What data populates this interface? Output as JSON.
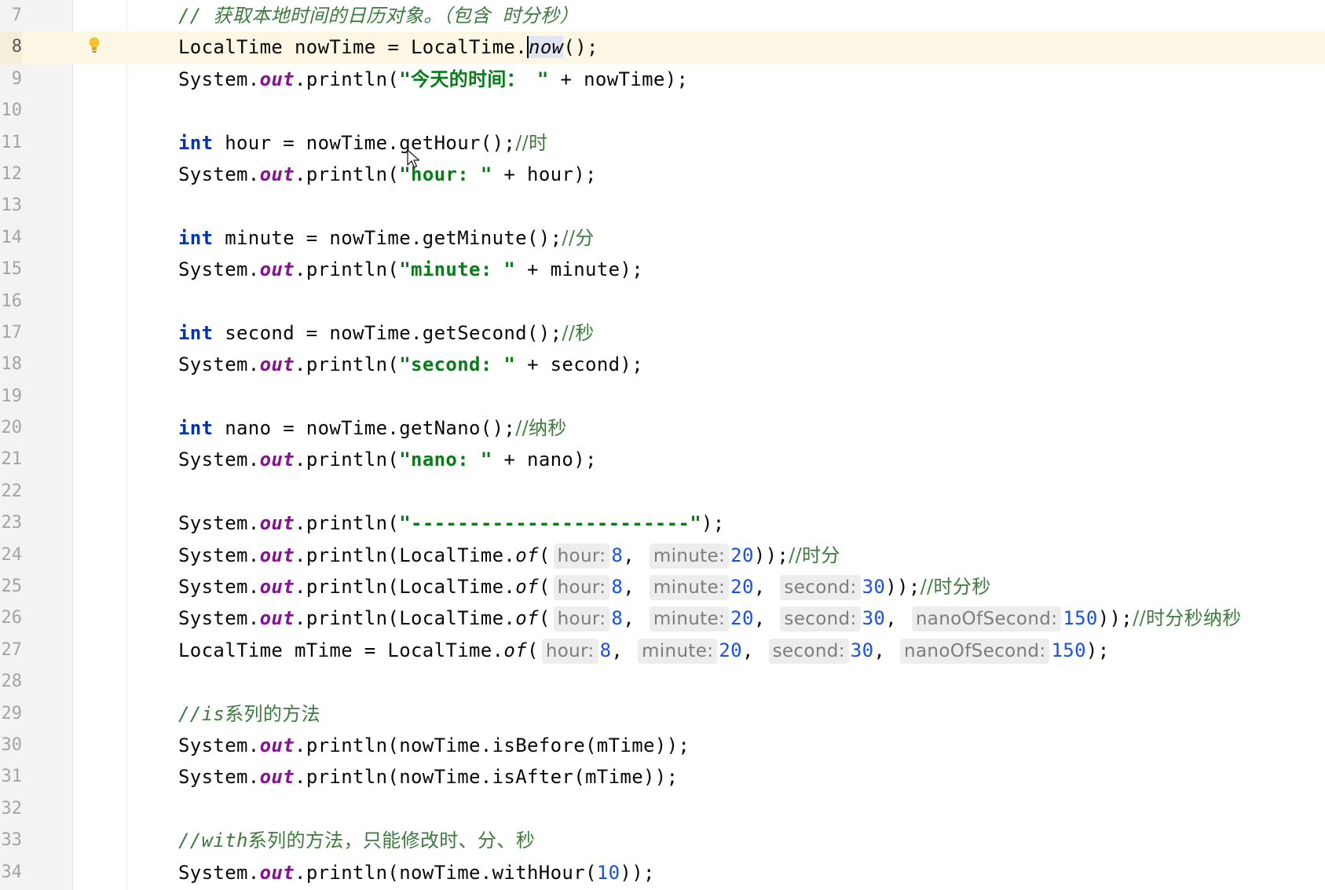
{
  "editor": {
    "language": "java",
    "current_line": "8",
    "lines": [
      {
        "num": "7"
      },
      {
        "num": "8"
      },
      {
        "num": "9"
      },
      {
        "num": "10"
      },
      {
        "num": "11"
      },
      {
        "num": "12"
      },
      {
        "num": "13"
      },
      {
        "num": "14"
      },
      {
        "num": "15"
      },
      {
        "num": "16"
      },
      {
        "num": "17"
      },
      {
        "num": "18"
      },
      {
        "num": "19"
      },
      {
        "num": "20"
      },
      {
        "num": "21"
      },
      {
        "num": "22"
      },
      {
        "num": "23"
      },
      {
        "num": "24"
      },
      {
        "num": "25"
      },
      {
        "num": "26"
      },
      {
        "num": "27"
      },
      {
        "num": "28"
      },
      {
        "num": "29"
      },
      {
        "num": "30"
      },
      {
        "num": "31"
      },
      {
        "num": "32"
      },
      {
        "num": "33"
      },
      {
        "num": "34"
      }
    ]
  },
  "t": {
    "c7": "// 获取本地时间的日历对象。（包含 时分秒）",
    "LocalTime": "LocalTime",
    "nowTime_eq": " nowTime = ",
    "dot": ".",
    "now": "now",
    "paren_semi": "();",
    "System": "System",
    "out": "out",
    "println_open": ".println(",
    "s9": "\"今天的时间： \"",
    "plus_nowTime": " + nowTime);",
    "int": "int",
    "hour_decl": " hour = nowTime.getHour();",
    "c11": "//时",
    "s12": "\"hour: \"",
    "plus_hour": " + hour);",
    "minute_decl": " minute = nowTime.getMinute();",
    "c14": "//分",
    "s15": "\"minute: \"",
    "plus_minute": " + minute);",
    "second_decl": " second = nowTime.getSecond();",
    "c17": "//秒",
    "s18": "\"second: \"",
    "plus_second": " + second);",
    "nano_decl": " nano = nowTime.getNano();",
    "c20": "//纳秒",
    "s21": "\"nano: \"",
    "plus_nano": " + nano);",
    "s23": "\"------------------------\"",
    "close_semi": ");",
    "println_lt": ".println(LocalTime.",
    "of": "of",
    "open": "(",
    "h_hour": "hour:",
    "h_minute": "minute:",
    "h_second": "second:",
    "h_nano": "nanoOfSecond:",
    "n8": "8",
    "n20": "20",
    "n30": "30",
    "n150": "150",
    "n10": "10",
    "comma": ", ",
    "close2": "));",
    "c24": "//时分",
    "c25": "//时分秒",
    "c26": "//时分秒纳秒",
    "mTime_eq": " mTime = LocalTime.",
    "c29a": "//is",
    "c29b": "系列的方法",
    "is_before": ".println(nowTime.isBefore(mTime));",
    "is_after": ".println(nowTime.isAfter(mTime));",
    "c33a": "//with",
    "c33b": "系列的方法，只能修改时、分、秒",
    "with_hour": ".println(nowTime.withHour(",
    "close3": "));"
  },
  "colors": {
    "keyword": "#0033b3",
    "field": "#871094",
    "string": "#067d17",
    "comment": "#3d7a3d",
    "number": "#1750eb",
    "current_line_bg": "#fcf7e4"
  },
  "icons": [
    "intention-bulb-icon",
    "mouse-pointer-icon"
  ]
}
